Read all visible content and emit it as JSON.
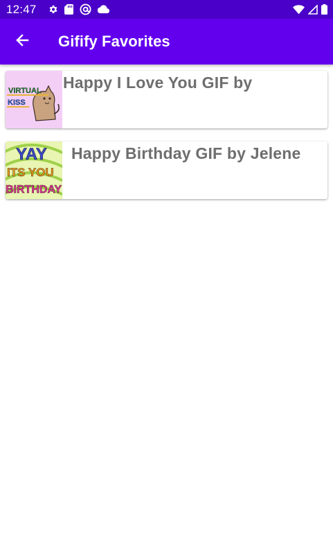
{
  "status_bar": {
    "time": "12:47",
    "left_icons": [
      "gear-icon",
      "sd-card-icon",
      "at-sign-icon",
      "cloud-icon"
    ],
    "right_icons": [
      "wifi-icon",
      "signal-icon",
      "battery-icon"
    ]
  },
  "app_bar": {
    "back_icon": "arrow-left-icon",
    "title": "Gifify Favorites",
    "background": "#6200ee",
    "status_background": "#4a00c8"
  },
  "favorites": [
    {
      "title": "Happy I Love You GIF by",
      "thumbnail": "virtual-kiss-cat-gif-thumbnail",
      "thumbnail_text": "VIRTUAL KISS"
    },
    {
      "title": "Happy Birthday GIF by Jelene",
      "thumbnail": "yay-its-your-birthday-gif-thumbnail",
      "thumbnail_text": "YAY IT'S YOUR BIRTHDAY"
    }
  ],
  "colors": {
    "card_title": "#6e6e6e",
    "background": "#ffffff"
  }
}
